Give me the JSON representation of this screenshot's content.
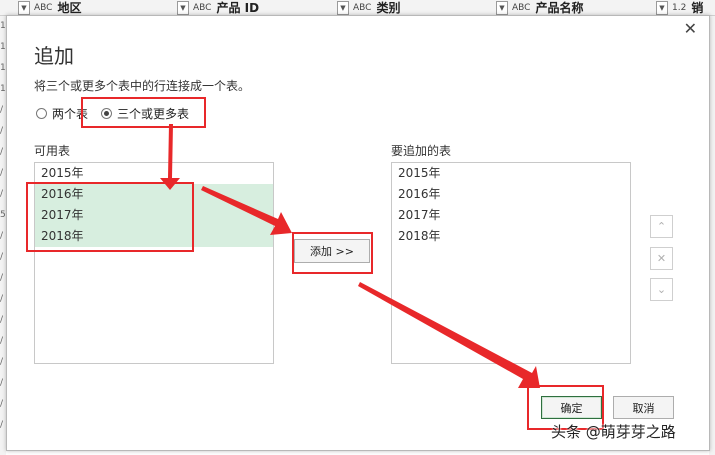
{
  "spreadsheet": {
    "columns": [
      {
        "type": "AB\nC",
        "name": "地区"
      },
      {
        "type": "AB\nC",
        "name": "产品 ID"
      },
      {
        "type": "AB\nC",
        "name": "类别"
      },
      {
        "type": "AB\nC",
        "name": "产品名称"
      },
      {
        "type": "1.2",
        "name": "销"
      }
    ],
    "row_markers": [
      "1",
      "1",
      "1",
      "1",
      "/",
      "/",
      "/",
      "/",
      "/",
      "5",
      "/",
      "/",
      "/",
      "/",
      "/",
      "/",
      "/",
      "/",
      "/",
      "/"
    ]
  },
  "dialog": {
    "close_glyph": "✕",
    "title": "追加",
    "description": "将三个或更多个表中的行连接成一个表。",
    "radio_two": "两个表",
    "radio_three": "三个或更多表",
    "available_label": "可用表",
    "available_items": [
      "2015年",
      "2016年",
      "2017年",
      "2018年"
    ],
    "selected_available": [
      "2016年",
      "2017年",
      "2018年"
    ],
    "append_label": "要追加的表",
    "append_items": [
      "2015年",
      "2016年",
      "2017年",
      "2018年"
    ],
    "add_button": "添加 >>",
    "ok_button": "确定",
    "cancel_button": "取消",
    "up_icon": "arrow-up-icon",
    "remove_icon": "remove-x-icon",
    "down_icon": "arrow-down-icon"
  },
  "watermark": "头条 @萌芽芽之路",
  "colors": {
    "highlight": "#e8282a",
    "selection": "#d7eedf",
    "primary_border": "#2f6f3f"
  }
}
